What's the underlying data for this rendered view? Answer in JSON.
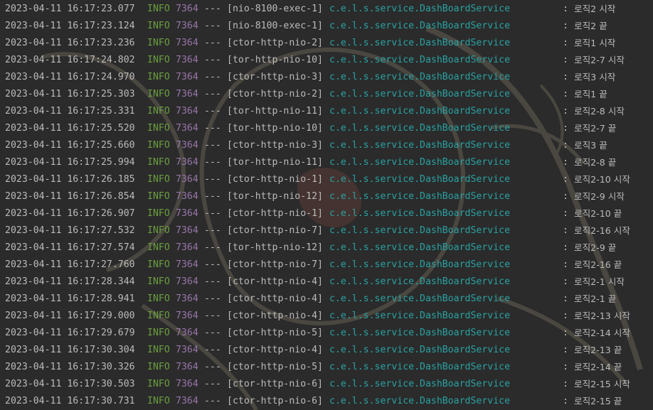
{
  "theme": {
    "background": "#2b2b2b",
    "text": "#bbbbbb",
    "level_color": "#6a9e3f",
    "pid_color": "#9876aa",
    "logger_color": "#2aa1a1"
  },
  "log_lines": [
    {
      "timestamp": "2023-04-11 16:17:23.077",
      "level": "INFO",
      "pid": "7364",
      "separator": "---",
      "thread": "[nio-8100-exec-1]",
      "logger": "c.e.l.s.service.DashBoardService",
      "colon": ":",
      "message": "로직2 시작"
    },
    {
      "timestamp": "2023-04-11 16:17:23.124",
      "level": "INFO",
      "pid": "7364",
      "separator": "---",
      "thread": "[nio-8100-exec-1]",
      "logger": "c.e.l.s.service.DashBoardService",
      "colon": ":",
      "message": "로직2 끝"
    },
    {
      "timestamp": "2023-04-11 16:17:23.236",
      "level": "INFO",
      "pid": "7364",
      "separator": "---",
      "thread": "[ctor-http-nio-2]",
      "logger": "c.e.l.s.service.DashBoardService",
      "colon": ":",
      "message": "로직1 시작"
    },
    {
      "timestamp": "2023-04-11 16:17:24.802",
      "level": "INFO",
      "pid": "7364",
      "separator": "---",
      "thread": "[tor-http-nio-10]",
      "logger": "c.e.l.s.service.DashBoardService",
      "colon": ":",
      "message": "로직2-7 시작"
    },
    {
      "timestamp": "2023-04-11 16:17:24.970",
      "level": "INFO",
      "pid": "7364",
      "separator": "---",
      "thread": "[ctor-http-nio-3]",
      "logger": "c.e.l.s.service.DashBoardService",
      "colon": ":",
      "message": "로직3 시작"
    },
    {
      "timestamp": "2023-04-11 16:17:25.303",
      "level": "INFO",
      "pid": "7364",
      "separator": "---",
      "thread": "[ctor-http-nio-2]",
      "logger": "c.e.l.s.service.DashBoardService",
      "colon": ":",
      "message": "로직1 끝"
    },
    {
      "timestamp": "2023-04-11 16:17:25.331",
      "level": "INFO",
      "pid": "7364",
      "separator": "---",
      "thread": "[tor-http-nio-11]",
      "logger": "c.e.l.s.service.DashBoardService",
      "colon": ":",
      "message": "로직2-8 시작"
    },
    {
      "timestamp": "2023-04-11 16:17:25.520",
      "level": "INFO",
      "pid": "7364",
      "separator": "---",
      "thread": "[tor-http-nio-10]",
      "logger": "c.e.l.s.service.DashBoardService",
      "colon": ":",
      "message": "로직2-7 끝"
    },
    {
      "timestamp": "2023-04-11 16:17:25.660",
      "level": "INFO",
      "pid": "7364",
      "separator": "---",
      "thread": "[ctor-http-nio-3]",
      "logger": "c.e.l.s.service.DashBoardService",
      "colon": ":",
      "message": "로직3 끝"
    },
    {
      "timestamp": "2023-04-11 16:17:25.994",
      "level": "INFO",
      "pid": "7364",
      "separator": "---",
      "thread": "[tor-http-nio-11]",
      "logger": "c.e.l.s.service.DashBoardService",
      "colon": ":",
      "message": "로직2-8 끝"
    },
    {
      "timestamp": "2023-04-11 16:17:26.185",
      "level": "INFO",
      "pid": "7364",
      "separator": "---",
      "thread": "[ctor-http-nio-1]",
      "logger": "c.e.l.s.service.DashBoardService",
      "colon": ":",
      "message": "로직2-10 시작"
    },
    {
      "timestamp": "2023-04-11 16:17:26.854",
      "level": "INFO",
      "pid": "7364",
      "separator": "---",
      "thread": "[tor-http-nio-12]",
      "logger": "c.e.l.s.service.DashBoardService",
      "colon": ":",
      "message": "로직2-9 시작"
    },
    {
      "timestamp": "2023-04-11 16:17:26.907",
      "level": "INFO",
      "pid": "7364",
      "separator": "---",
      "thread": "[ctor-http-nio-1]",
      "logger": "c.e.l.s.service.DashBoardService",
      "colon": ":",
      "message": "로직2-10 끝"
    },
    {
      "timestamp": "2023-04-11 16:17:27.532",
      "level": "INFO",
      "pid": "7364",
      "separator": "---",
      "thread": "[ctor-http-nio-7]",
      "logger": "c.e.l.s.service.DashBoardService",
      "colon": ":",
      "message": "로직2-16 시작"
    },
    {
      "timestamp": "2023-04-11 16:17:27.574",
      "level": "INFO",
      "pid": "7364",
      "separator": "---",
      "thread": "[tor-http-nio-12]",
      "logger": "c.e.l.s.service.DashBoardService",
      "colon": ":",
      "message": "로직2-9 끝"
    },
    {
      "timestamp": "2023-04-11 16:17:27.760",
      "level": "INFO",
      "pid": "7364",
      "separator": "---",
      "thread": "[ctor-http-nio-7]",
      "logger": "c.e.l.s.service.DashBoardService",
      "colon": ":",
      "message": "로직2-16 끝"
    },
    {
      "timestamp": "2023-04-11 16:17:28.344",
      "level": "INFO",
      "pid": "7364",
      "separator": "---",
      "thread": "[ctor-http-nio-4]",
      "logger": "c.e.l.s.service.DashBoardService",
      "colon": ":",
      "message": "로직2-1 시작"
    },
    {
      "timestamp": "2023-04-11 16:17:28.941",
      "level": "INFO",
      "pid": "7364",
      "separator": "---",
      "thread": "[ctor-http-nio-4]",
      "logger": "c.e.l.s.service.DashBoardService",
      "colon": ":",
      "message": "로직2-1 끝"
    },
    {
      "timestamp": "2023-04-11 16:17:29.000",
      "level": "INFO",
      "pid": "7364",
      "separator": "---",
      "thread": "[ctor-http-nio-4]",
      "logger": "c.e.l.s.service.DashBoardService",
      "colon": ":",
      "message": "로직2-13 시작"
    },
    {
      "timestamp": "2023-04-11 16:17:29.679",
      "level": "INFO",
      "pid": "7364",
      "separator": "---",
      "thread": "[ctor-http-nio-5]",
      "logger": "c.e.l.s.service.DashBoardService",
      "colon": ":",
      "message": "로직2-14 시작"
    },
    {
      "timestamp": "2023-04-11 16:17:30.304",
      "level": "INFO",
      "pid": "7364",
      "separator": "---",
      "thread": "[ctor-http-nio-4]",
      "logger": "c.e.l.s.service.DashBoardService",
      "colon": ":",
      "message": "로직2-13 끝"
    },
    {
      "timestamp": "2023-04-11 16:17:30.326",
      "level": "INFO",
      "pid": "7364",
      "separator": "---",
      "thread": "[ctor-http-nio-5]",
      "logger": "c.e.l.s.service.DashBoardService",
      "colon": ":",
      "message": "로직2-14 끝"
    },
    {
      "timestamp": "2023-04-11 16:17:30.503",
      "level": "INFO",
      "pid": "7364",
      "separator": "---",
      "thread": "[ctor-http-nio-6]",
      "logger": "c.e.l.s.service.DashBoardService",
      "colon": ":",
      "message": "로직2-15 시작"
    },
    {
      "timestamp": "2023-04-11 16:17:30.731",
      "level": "INFO",
      "pid": "7364",
      "separator": "---",
      "thread": "[ctor-http-nio-6]",
      "logger": "c.e.l.s.service.DashBoardService",
      "colon": ":",
      "message": "로직2-15 끝"
    }
  ]
}
